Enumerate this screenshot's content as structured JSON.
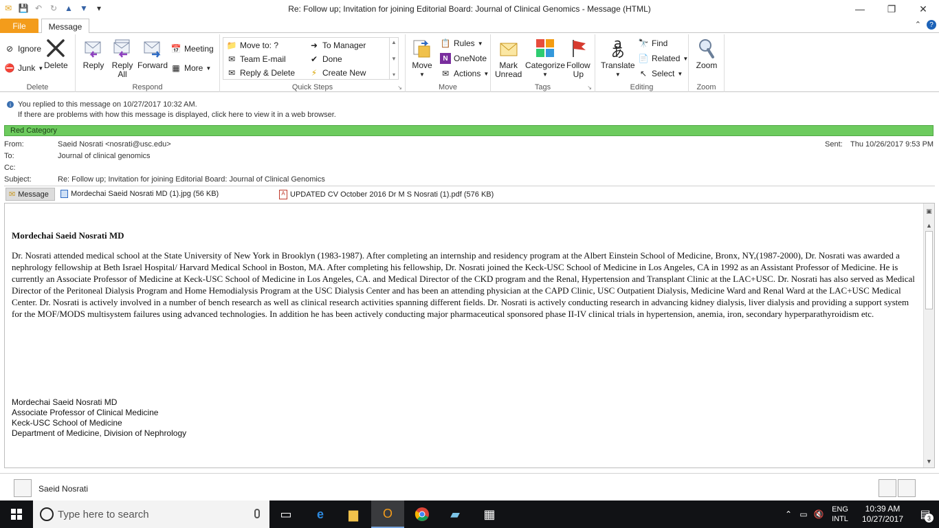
{
  "window": {
    "title": "Re: Follow up; Invitation for joining Editorial Board: Journal of Clinical Genomics  -  Message (HTML)"
  },
  "tabs": {
    "file": "File",
    "message": "Message"
  },
  "ribbon": {
    "delete": {
      "label": "Delete",
      "ignore": "Ignore",
      "junk": "Junk",
      "delete": "Delete"
    },
    "respond": {
      "label": "Respond",
      "reply": "Reply",
      "reply_all_1": "Reply",
      "reply_all_2": "All",
      "forward": "Forward",
      "meeting": "Meeting",
      "more": "More"
    },
    "quick_steps": {
      "label": "Quick Steps",
      "move_to": "Move to: ?",
      "team_email": "Team E-mail",
      "reply_delete": "Reply & Delete",
      "to_manager": "To Manager",
      "done": "Done",
      "create_new": "Create New"
    },
    "move": {
      "label": "Move",
      "move": "Move",
      "rules": "Rules",
      "onenote": "OneNote",
      "actions": "Actions"
    },
    "tags": {
      "label": "Tags",
      "mark_unread_1": "Mark",
      "mark_unread_2": "Unread",
      "categorize": "Categorize",
      "follow_up_1": "Follow",
      "follow_up_2": "Up"
    },
    "editing": {
      "label": "Editing",
      "translate": "Translate",
      "find": "Find",
      "related": "Related",
      "select": "Select"
    },
    "zoom": {
      "label": "Zoom",
      "zoom": "Zoom"
    }
  },
  "info": {
    "line1": "You replied to this message on 10/27/2017 10:32 AM.",
    "line2": "If there are problems with how this message is displayed, click here to view it in a web browser."
  },
  "category": "Red Category",
  "headers": {
    "from_label": "From:",
    "from": "Saeid Nosrati <nosrati@usc.edu>",
    "to_label": "To:",
    "to": "Journal of clinical genomics",
    "cc_label": "Cc:",
    "subject_label": "Subject:",
    "subject": "Re: Follow up; Invitation for joining Editorial Board: Journal of Clinical Genomics",
    "sent_label": "Sent:",
    "sent": "Thu 10/26/2017 9:53 PM"
  },
  "attachments": {
    "message": "Message",
    "att1": "Mordechai Saeid Nosrati MD (1).jpg (56 KB)",
    "att2": "UPDATED CV October 2016 Dr M S Nosrati (1).pdf (576 KB)"
  },
  "body": {
    "name": "Mordechai Saeid Nosrati MD",
    "paragraph": "Dr. Nosrati attended medical school at the State University of New York in Brooklyn (1983-1987). After completing an internship and residency program at the Albert Einstein School of Medicine, Bronx, NY,(1987-2000), Dr. Nosrati was awarded a nephrology fellowship at Beth Israel Hospital/ Harvard Medical School in Boston, MA. After completing his fellowship, Dr. Nosrati joined the Keck-USC School of Medicine in Los Angeles, CA in 1992 as an Assistant Professor of Medicine. He is currently an Associate Professor of Medicine at Keck-USC School of Medicine in Los Angeles, CA. and Medical Director of the CKD program and the Renal, Hypertension and Transplant Clinic at the LAC+USC. Dr. Nosrati has also served as Medical Director of the Peritoneal Dialysis Program and Home Hemodialysis Program at the USC Dialysis Center and has been an attending physician at the CAPD Clinic, USC Outpatient Dialysis, Medicine Ward and Renal Ward at the LAC+USC Medical Center. Dr. Nosrati is actively involved in a number of bench research as well as clinical research activities spanning different fields. Dr. Nosrati is actively conducting research in advancing kidney dialysis, liver dialysis and providing a support system for the MOF/MODS multisystem failures using advanced technologies. In addition he has been actively conducting major pharmaceutical sponsored phase II-IV clinical trials in hypertension, anemia, iron, secondary hyperparathyroidism etc.",
    "signature": [
      "Mordechai Saeid Nosrati MD",
      "Associate Professor of Clinical Medicine",
      "Keck-USC School of Medicine",
      "Department of Medicine, Division of Nephrology"
    ]
  },
  "people_pane": {
    "name": "Saeid Nosrati"
  },
  "taskbar": {
    "search_placeholder": "Type here to search",
    "lang_1": "ENG",
    "lang_2": "INTL",
    "time": "10:39 AM",
    "date": "10/27/2017",
    "notifications": "3"
  },
  "colors": {
    "file_tab": "#f39c1b",
    "category": "#6dcb5e",
    "taskbar": "#111215"
  }
}
